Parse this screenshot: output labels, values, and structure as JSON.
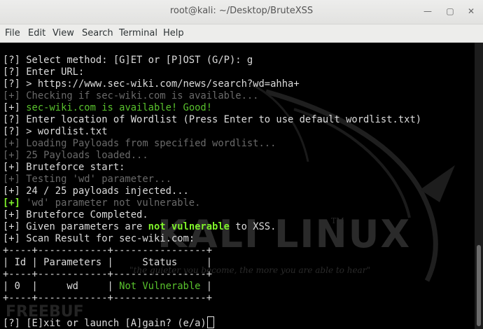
{
  "window": {
    "title": "root@kali: ~/Desktop/BruteXSS"
  },
  "menu": [
    "File",
    "Edit",
    "View",
    "Search",
    "Terminal",
    "Help"
  ],
  "watermark": {
    "brand": "KALI LINUX",
    "tm": "TM",
    "quote": "\"the quieter you become, the more you are able to hear\"",
    "corner": "FREEBUF"
  },
  "lines": [
    [
      {
        "t": "[?] Select method: [G]ET or [P]OST (G/P): g",
        "c": ""
      }
    ],
    [
      {
        "t": "[?] Enter URL:",
        "c": ""
      }
    ],
    [
      {
        "t": "[?] > https://www.sec-wiki.com/news/search?wd=ahha+",
        "c": ""
      }
    ],
    [
      {
        "t": "[+] Checking if sec-wiki.com is available...",
        "c": "dim"
      }
    ],
    [
      {
        "t": "[+] ",
        "c": ""
      },
      {
        "t": "sec-wiki.com is available! Good!",
        "c": "green"
      }
    ],
    [
      {
        "t": "[?] Enter location of Wordlist (Press Enter to use default wordlist.txt)",
        "c": ""
      }
    ],
    [
      {
        "t": "[?] > wordlist.txt",
        "c": ""
      }
    ],
    [
      {
        "t": "[+] Loading Payloads from specified wordlist...",
        "c": "dim"
      }
    ],
    [
      {
        "t": "[+] 25 Payloads loaded...",
        "c": "dim"
      }
    ],
    [
      {
        "t": "[+] Bruteforce start:",
        "c": ""
      }
    ],
    [
      {
        "t": "[+] Testing 'wd' parameter...",
        "c": "dim"
      }
    ],
    [
      {
        "t": "[+] 24 / 25 payloads injected...",
        "c": ""
      }
    ],
    [
      {
        "t": "[+]",
        "c": "bgreen"
      },
      {
        "t": " 'wd' parameter not vulnerable.",
        "c": "dim"
      }
    ],
    [
      {
        "t": "[+] Bruteforce Completed.",
        "c": ""
      }
    ],
    [
      {
        "t": "[+] Given parameters are ",
        "c": ""
      },
      {
        "t": "not vulnerable",
        "c": "bgreen"
      },
      {
        "t": " to XSS.",
        "c": ""
      }
    ],
    [
      {
        "t": "[+] Scan Result for sec-wiki.com:",
        "c": ""
      }
    ],
    [
      {
        "t": "+----+------------+----------------+",
        "c": ""
      }
    ],
    [
      {
        "t": "| Id | Parameters |     Status     |",
        "c": ""
      }
    ],
    [
      {
        "t": "+----+------------+----------------+",
        "c": ""
      }
    ],
    [
      {
        "t": "| 0  |     wd     | ",
        "c": ""
      },
      {
        "t": "Not Vulnerable",
        "c": "green"
      },
      {
        "t": " |",
        "c": ""
      }
    ],
    [
      {
        "t": "+----+------------+----------------+",
        "c": ""
      }
    ],
    [
      {
        "t": "",
        "c": ""
      }
    ],
    [
      {
        "t": "[?] [E]xit or launch [A]gain? (e/a)",
        "c": ""
      }
    ]
  ]
}
